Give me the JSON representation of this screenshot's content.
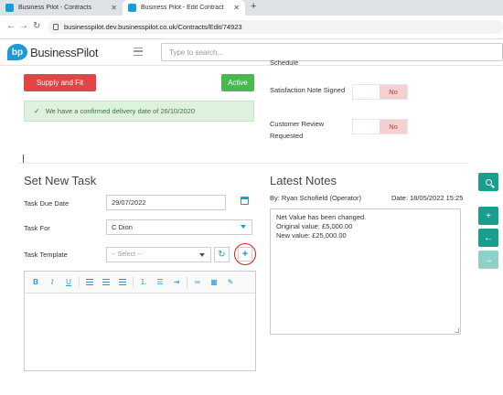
{
  "browser": {
    "tabs": [
      {
        "title": "Business Pilot - Contracts",
        "active": false
      },
      {
        "title": "Business Pilot - Edit Contract",
        "active": true
      }
    ],
    "new_tab_icon": "plus-icon",
    "url": "businesspilot.dev.businesspilot.co.uk/Contracts/Edit/74923"
  },
  "app": {
    "logo_mark": "bp",
    "logo_text": "BusinessPilot",
    "search_placeholder": "Type to search..."
  },
  "contract": {
    "supply_fit_label": "Supply and Fit",
    "status_label": "Active",
    "alert_text": "We have a confirmed delivery date of 26/10/2020",
    "schedule_partial": "Schedule",
    "satisfaction_note_label": "Satisfaction Note Signed",
    "satisfaction_note_value": "No",
    "customer_review_label": "Customer Review Requested",
    "customer_review_value": "No"
  },
  "task": {
    "section_title": "Set New Task",
    "due_date_label": "Task Due Date",
    "due_date_value": "29/07/2022",
    "task_for_label": "Task For",
    "task_for_value": "C Dion",
    "template_label": "Task Template",
    "template_placeholder": "-- Select --",
    "editor_tools": [
      "B",
      "I",
      "U"
    ]
  },
  "notes": {
    "section_title": "Latest Notes",
    "author": "By: Ryan Schofield (Operator)",
    "date": "Date: 18/05/2022 15:25",
    "lines": [
      "Net Value has been changed.",
      "Original value: £5,000.00",
      "New value: £25,000.00"
    ]
  },
  "colors": {
    "accent": "#1a9ad6",
    "teal": "#1a9e8f",
    "danger": "#e14545",
    "success": "#48b84f"
  }
}
